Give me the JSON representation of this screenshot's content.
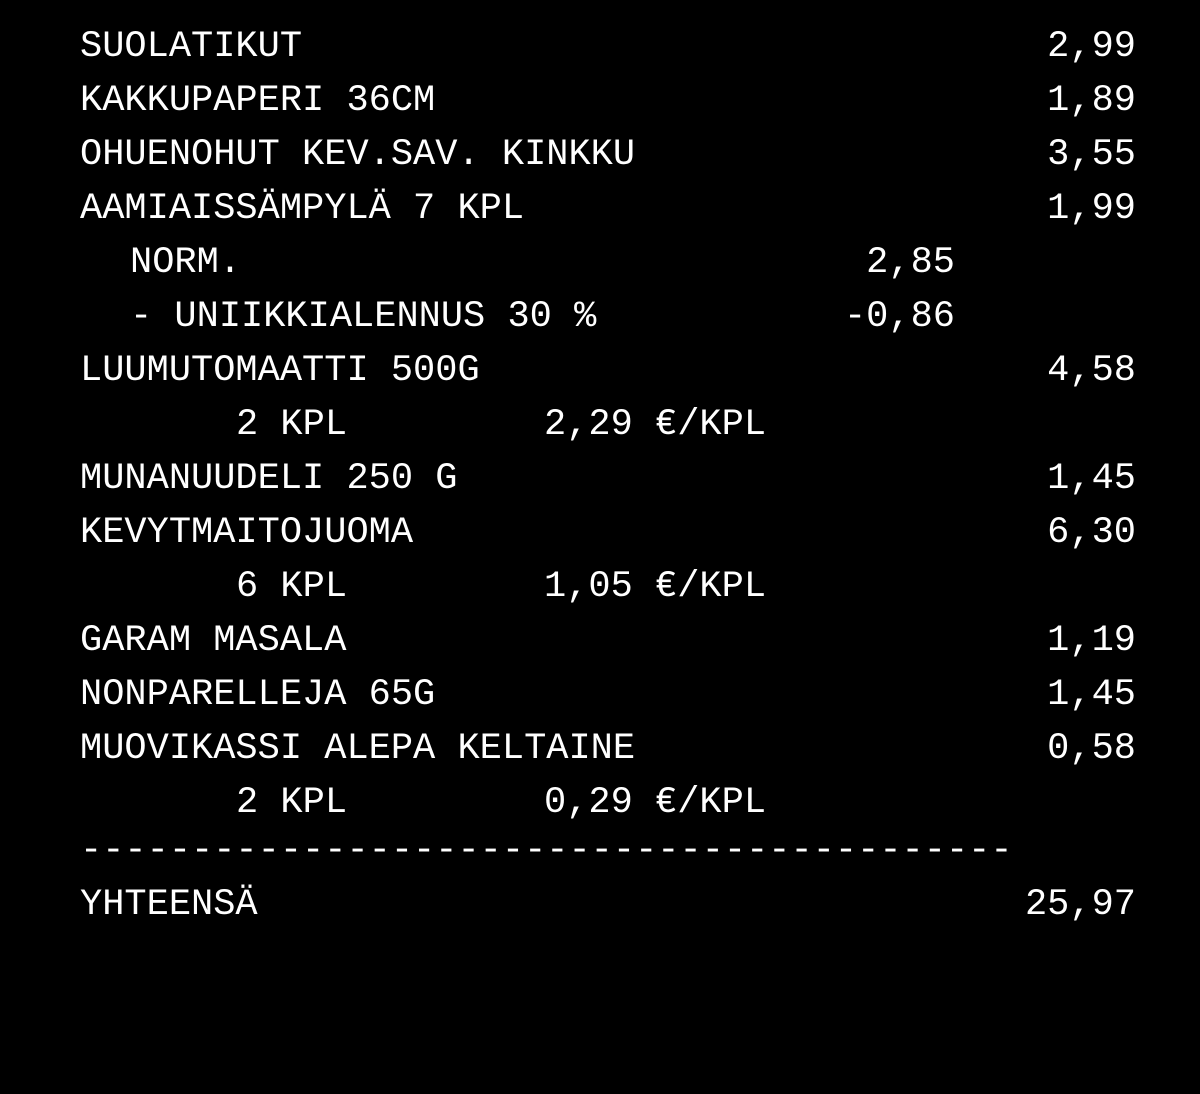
{
  "items": [
    {
      "name": "SUOLATIKUT",
      "amount": "2,99"
    },
    {
      "name": "KAKKUPAPERI 36CM",
      "amount": "1,89"
    },
    {
      "name": "OHUENOHUT KEV.SAV. KINKKU",
      "amount": "3,55"
    },
    {
      "name": "AAMIAISSÄMPYLÄ 7 KPL",
      "amount": "1,99"
    },
    {
      "sub_label": "NORM.",
      "sub_amount": "2,85"
    },
    {
      "sub_label": "- UNIIKKIALENNUS 30 %",
      "sub_amount": "-0,86"
    },
    {
      "name": "LUUMUTOMAATTI 500G",
      "amount": "4,58"
    },
    {
      "qty": "2 KPL",
      "unit_price": "2,29 €/KPL"
    },
    {
      "name": "MUNANUUDELI 250 G",
      "amount": "1,45"
    },
    {
      "name": "KEVYTMAITOJUOMA",
      "amount": "6,30"
    },
    {
      "qty": "6 KPL",
      "unit_price": "1,05 €/KPL"
    },
    {
      "name": "GARAM MASALA",
      "amount": "1,19"
    },
    {
      "name": "NONPARELLEJA 65G",
      "amount": "1,45"
    },
    {
      "name": "MUOVIKASSI ALEPA KELTAINE",
      "amount": "0,58"
    },
    {
      "qty": "2 KPL",
      "unit_price": "0,29 €/KPL"
    }
  ],
  "divider": "------------------------------------------",
  "total": {
    "label": "YHTEENSÄ",
    "amount": "25,97"
  },
  "colors": {
    "background": "#000000",
    "text": "#ffffff"
  }
}
